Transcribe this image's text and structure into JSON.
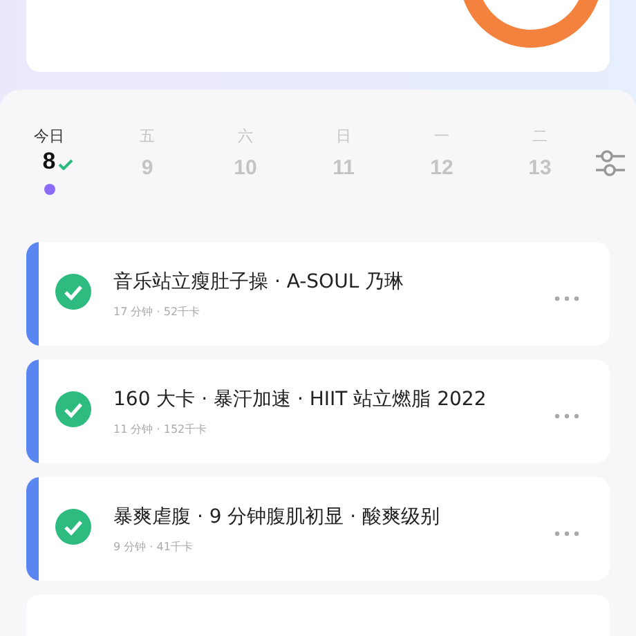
{
  "days": [
    {
      "weekday": "今日",
      "date": "8",
      "selected": true,
      "done": true,
      "color": "#8b6cf6"
    },
    {
      "weekday": "五",
      "date": "9",
      "selected": false,
      "done": false
    },
    {
      "weekday": "六",
      "date": "10",
      "selected": false,
      "done": false
    },
    {
      "weekday": "日",
      "date": "11",
      "selected": false,
      "done": false
    },
    {
      "weekday": "一",
      "date": "12",
      "selected": false,
      "done": false
    },
    {
      "weekday": "二",
      "date": "13",
      "selected": false,
      "done": false
    }
  ],
  "courses": [
    {
      "title": "音乐站立瘦肚子操 · A-SOUL 乃琳",
      "meta": "17 分钟 · 52千卡",
      "done": true
    },
    {
      "title": "160 大卡 · 暴汗加速 · HIIT 站立燃脂 2022",
      "meta": "11 分钟 · 152千卡",
      "done": true
    },
    {
      "title": "暴爽虐腹 · 9 分钟腹肌初显 · 酸爽级别",
      "meta": "9 分钟 · 41千卡",
      "done": true
    }
  ]
}
